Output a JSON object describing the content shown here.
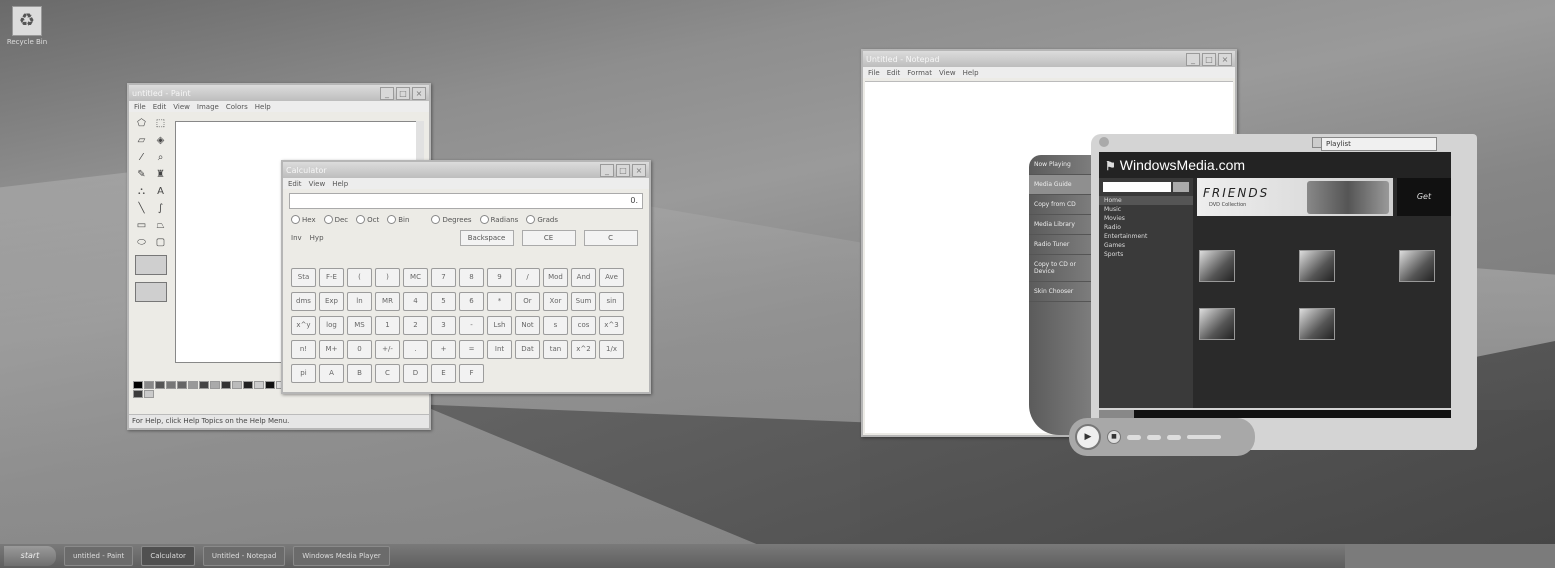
{
  "desktop": {
    "icon_label": "Recycle Bin"
  },
  "paint": {
    "title": "untitled - Paint",
    "menu": [
      "File",
      "Edit",
      "View",
      "Image",
      "Colors",
      "Help"
    ],
    "status": "For Help, click Help Topics on the Help Menu."
  },
  "calculator": {
    "title": "Calculator",
    "menu": [
      "Edit",
      "View",
      "Help"
    ],
    "display": "0.",
    "bases": [
      "Hex",
      "Dec",
      "Oct",
      "Bin"
    ],
    "angles": [
      "Degrees",
      "Radians",
      "Grads"
    ],
    "inv": "Inv",
    "hyp": "Hyp",
    "backspace": "Backspace",
    "ce": "CE",
    "c": "C",
    "keys": [
      "Sta",
      "F-E",
      "(",
      ")",
      "MC",
      "7",
      "8",
      "9",
      "/",
      "Mod",
      "And",
      "Ave",
      "dms",
      "Exp",
      "ln",
      "MR",
      "4",
      "5",
      "6",
      "*",
      "Or",
      "Xor",
      "Sum",
      "sin",
      "x^y",
      "log",
      "MS",
      "1",
      "2",
      "3",
      "-",
      "Lsh",
      "Not",
      "s",
      "cos",
      "x^3",
      "n!",
      "M+",
      "0",
      "+/-",
      ".",
      "+",
      "=",
      "Int",
      "Dat",
      "tan",
      "x^2",
      "1/x",
      "pi",
      "A",
      "B",
      "C",
      "D",
      "E",
      "F"
    ]
  },
  "notepad": {
    "title": "Untitled - Notepad",
    "menu": [
      "File",
      "Edit",
      "Format",
      "View",
      "Help"
    ]
  },
  "media_player": {
    "dropdown": "Playlist",
    "site_title": "WindowsMedia.com",
    "nav": [
      "Now Playing",
      "Media Guide",
      "Copy from CD",
      "Media Library",
      "Radio Tuner",
      "Copy to CD or Device",
      "Skin Chooser"
    ],
    "left_items": [
      "Home",
      "Music",
      "Movies",
      "Radio",
      "Entertainment",
      "Games",
      "Sports"
    ],
    "banner_text": "FRIENDS",
    "banner_sub": "DVD Collection",
    "ad_text": "Get"
  },
  "taskbar": {
    "start_label": "start",
    "tasks": [
      "untitled - Paint",
      "Calculator",
      "Untitled - Notepad",
      "Windows Media Player"
    ]
  }
}
